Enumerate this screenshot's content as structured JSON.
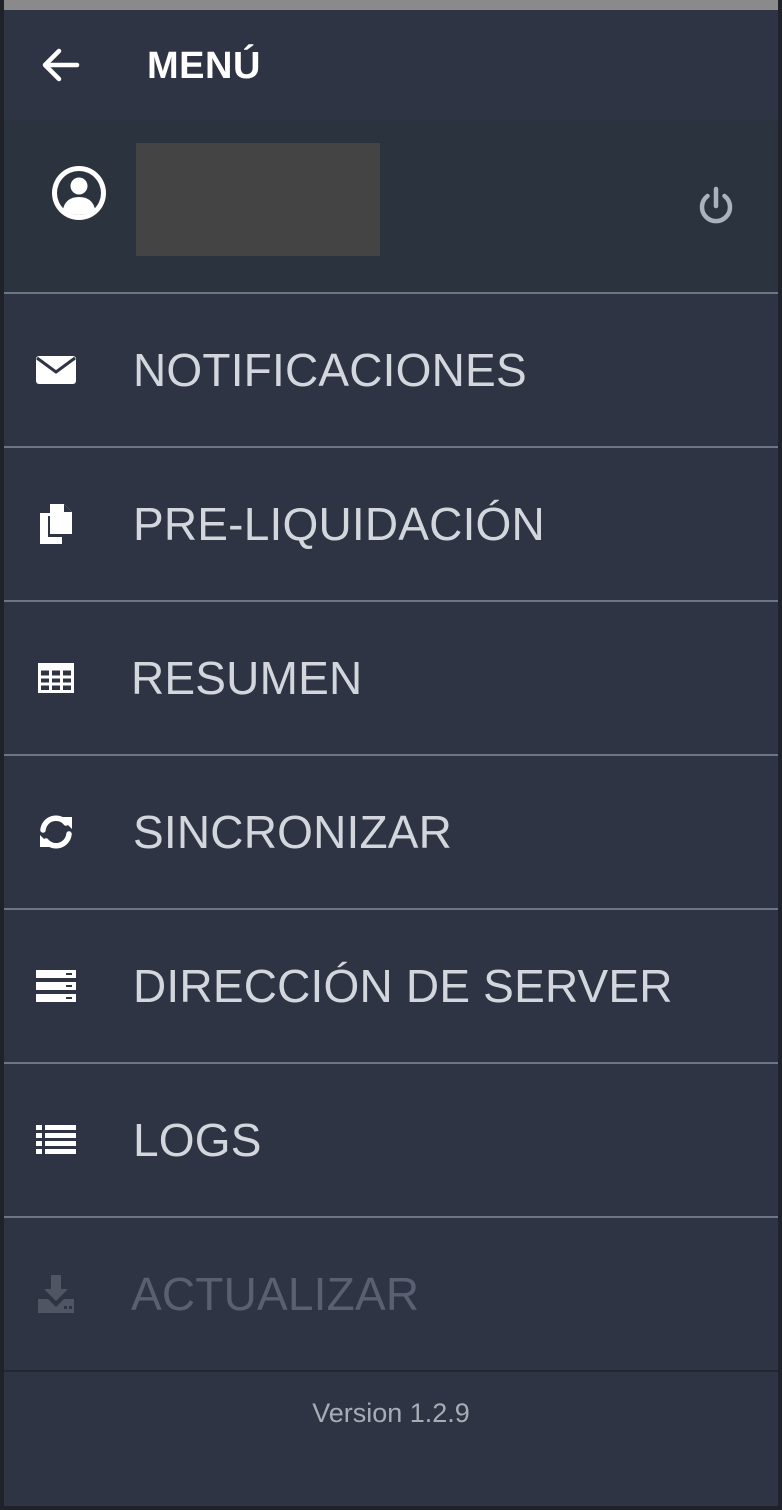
{
  "header": {
    "title": "MENÚ",
    "back_icon": "arrow-left-icon"
  },
  "user": {
    "avatar_icon": "user-circle-icon",
    "name": "",
    "power_icon": "power-icon"
  },
  "menu": {
    "items": [
      {
        "label": "NOTIFICACIONES",
        "icon": "envelope-icon",
        "enabled": true
      },
      {
        "label": "PRE-LIQUIDACIÓN",
        "icon": "documents-icon",
        "enabled": true
      },
      {
        "label": "RESUMEN",
        "icon": "table-icon",
        "enabled": true
      },
      {
        "label": "SINCRONIZAR",
        "icon": "sync-icon",
        "enabled": true
      },
      {
        "label": "DIRECCIÓN DE SERVER",
        "icon": "server-icon",
        "enabled": true
      },
      {
        "label": "LOGS",
        "icon": "list-icon",
        "enabled": true
      },
      {
        "label": "ACTUALIZAR",
        "icon": "download-icon",
        "enabled": false
      }
    ]
  },
  "footer": {
    "version": "Version 1.2.9"
  },
  "colors": {
    "background": "#2f3444",
    "user_panel": "#2b333e",
    "divider": "#6b7583",
    "label": "#d3d7dd",
    "disabled_label": "#596071",
    "icon": "#ffffff",
    "disabled_icon": "#4f5563"
  }
}
